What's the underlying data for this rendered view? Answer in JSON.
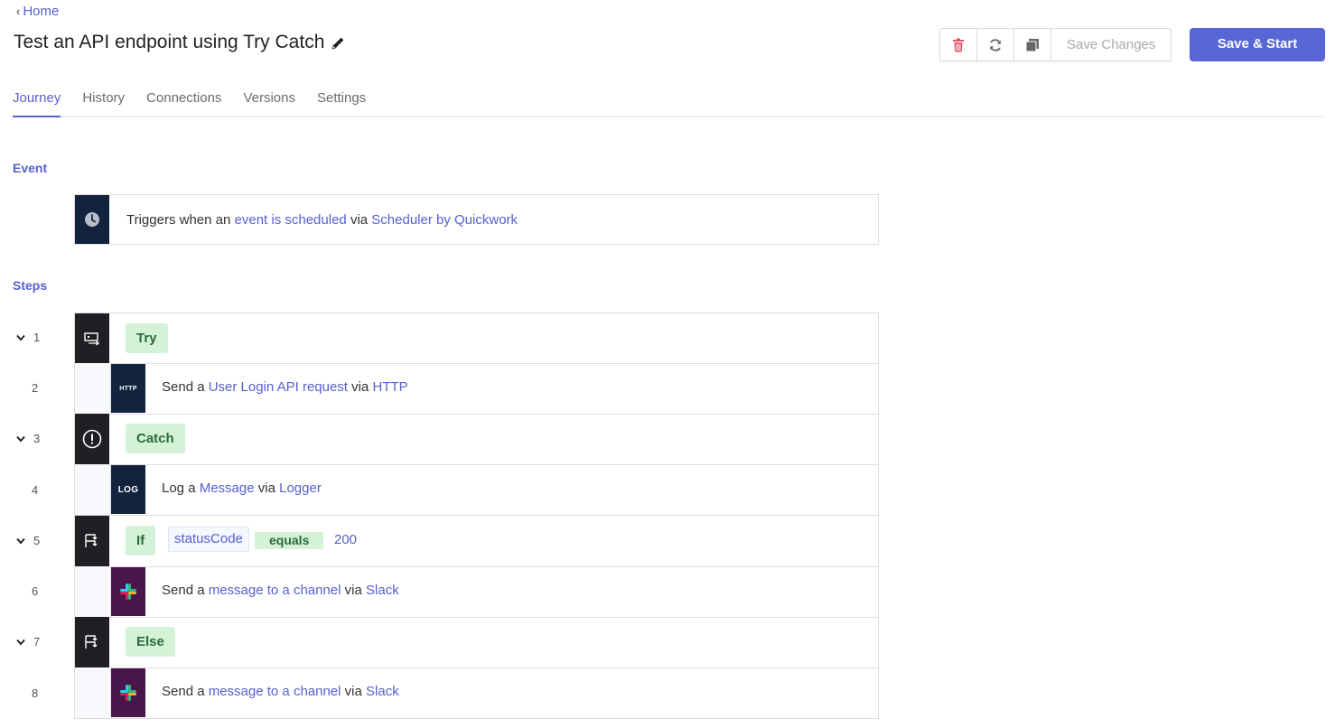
{
  "nav": {
    "back_label": "Home"
  },
  "header": {
    "title": "Test an API endpoint using Try Catch"
  },
  "toolbar": {
    "save_changes_label": "Save Changes",
    "save_start_label": "Save & Start"
  },
  "tabs": [
    "Journey",
    "History",
    "Connections",
    "Versions",
    "Settings"
  ],
  "event": {
    "section_label": "Event",
    "prefix": "Triggers when an",
    "trigger_link": "event is scheduled",
    "via": "via",
    "app_link": "Scheduler by Quickwork"
  },
  "steps": {
    "section_label": "Steps",
    "items": [
      {
        "number": "1",
        "pill": "Try"
      },
      {
        "number": "2",
        "verb": "Send a",
        "action_link": "User Login API request",
        "via": "via",
        "app_link": "HTTP",
        "icon_text": "HTTP"
      },
      {
        "number": "3",
        "pill": "Catch"
      },
      {
        "number": "4",
        "verb": "Log a",
        "action_link": "Message",
        "via": "via",
        "app_link": "Logger",
        "icon_text": "LOG"
      },
      {
        "number": "5",
        "pill": "If",
        "condition_var": "statusCode",
        "condition_op": "equals",
        "condition_value": "200"
      },
      {
        "number": "6",
        "verb": "Send a",
        "action_link": "message to a channel",
        "via": "via",
        "app_link": "Slack"
      },
      {
        "number": "7",
        "pill": "Else"
      },
      {
        "number": "8",
        "verb": "Send a",
        "action_link": "message to a channel",
        "via": "via",
        "app_link": "Slack"
      }
    ]
  },
  "colors": {
    "accent": "#5866d6",
    "link": "#5660d0",
    "pill_bg": "#d3f2d6",
    "pill_text": "#2b6b39",
    "icon_navy": "#13233d",
    "slack_plum": "#4a154b"
  }
}
